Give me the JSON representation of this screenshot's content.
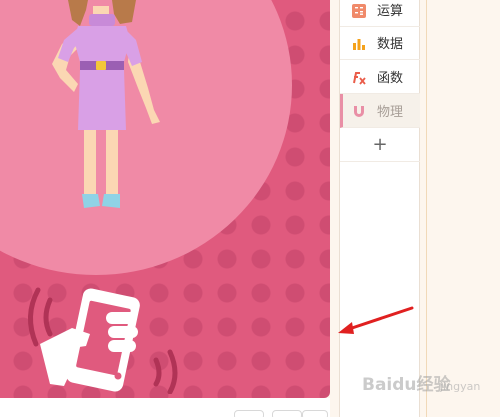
{
  "panel": {
    "items": [
      {
        "label": "运算",
        "icon": "calculator-icon",
        "color": "#f08a6a"
      },
      {
        "label": "数据",
        "icon": "bar-chart-icon",
        "color": "#f4a21c"
      },
      {
        "label": "函数",
        "icon": "function-icon",
        "color": "#ea5d4a"
      },
      {
        "label": "物理",
        "icon": "magnet-icon",
        "color": "#e98fa6"
      }
    ],
    "add_label": "+"
  },
  "watermark": {
    "brand": "Baidu",
    "suffix": "经验",
    "sub": "jingyan"
  },
  "colors": {
    "canvas_bg": "#e05a7e",
    "circle": "#f08aa6",
    "arrow": "#e02020"
  }
}
